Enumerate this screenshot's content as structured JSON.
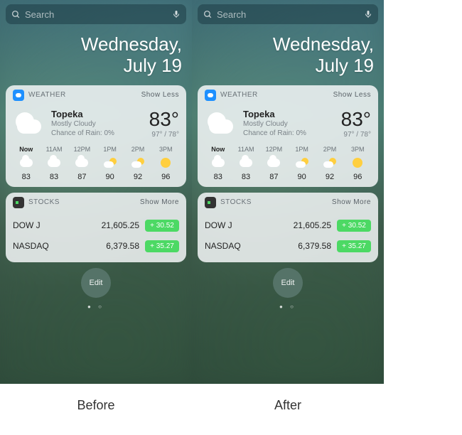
{
  "search": {
    "placeholder": "Search"
  },
  "date": {
    "weekday": "Wednesday,",
    "monthday": "July 19"
  },
  "weather": {
    "widget_title": "WEATHER",
    "toggle": "Show Less",
    "city": "Topeka",
    "condition": "Mostly Cloudy",
    "chance": "Chance of Rain: 0%",
    "temp": "83°",
    "range": "97° / 78°",
    "hours": [
      {
        "label": "Now",
        "icon": "cloud",
        "temp": "83",
        "now": true
      },
      {
        "label": "11AM",
        "icon": "cloud",
        "temp": "83"
      },
      {
        "label": "12PM",
        "icon": "cloud",
        "temp": "87"
      },
      {
        "label": "1PM",
        "icon": "partly",
        "temp": "90"
      },
      {
        "label": "2PM",
        "icon": "partly",
        "temp": "92"
      },
      {
        "label": "3PM",
        "icon": "sun",
        "temp": "96"
      }
    ]
  },
  "stocks": {
    "widget_title": "STOCKS",
    "toggle": "Show More",
    "rows": [
      {
        "name": "DOW J",
        "value": "21,605.25",
        "change": "+ 30.52"
      },
      {
        "name": "NASDAQ",
        "value": "6,379.58",
        "change": "+ 35.27"
      }
    ]
  },
  "edit_label": "Edit",
  "caption_before": "Before",
  "caption_after": "After"
}
